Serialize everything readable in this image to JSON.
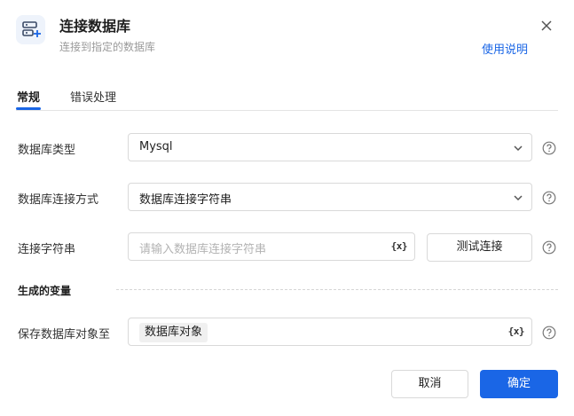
{
  "header": {
    "title": "连接数据库",
    "subtitle": "连接到指定的数据库",
    "help_link": "使用说明",
    "icon": "database-connect-icon",
    "close_icon": "close-icon"
  },
  "tabs": [
    {
      "label": "常规",
      "active": true
    },
    {
      "label": "错误处理",
      "active": false
    }
  ],
  "form": {
    "db_type": {
      "label": "数据库类型",
      "value": "Mysql"
    },
    "conn_method": {
      "label": "数据库连接方式",
      "value": "数据库连接字符串"
    },
    "conn_string": {
      "label": "连接字符串",
      "placeholder": "请输入数据库连接字符串",
      "value": "",
      "variable_icon": "{x}",
      "test_button": "测试连接"
    }
  },
  "output": {
    "section_title": "生成的变量",
    "save_to": {
      "label": "保存数据库对象至",
      "value": "数据库对象",
      "variable_icon": "{x}"
    }
  },
  "footer": {
    "cancel": "取消",
    "confirm": "确定"
  },
  "colors": {
    "accent": "#1a66e6",
    "border": "#d9d9d9",
    "muted_text": "#9a9a9a"
  }
}
